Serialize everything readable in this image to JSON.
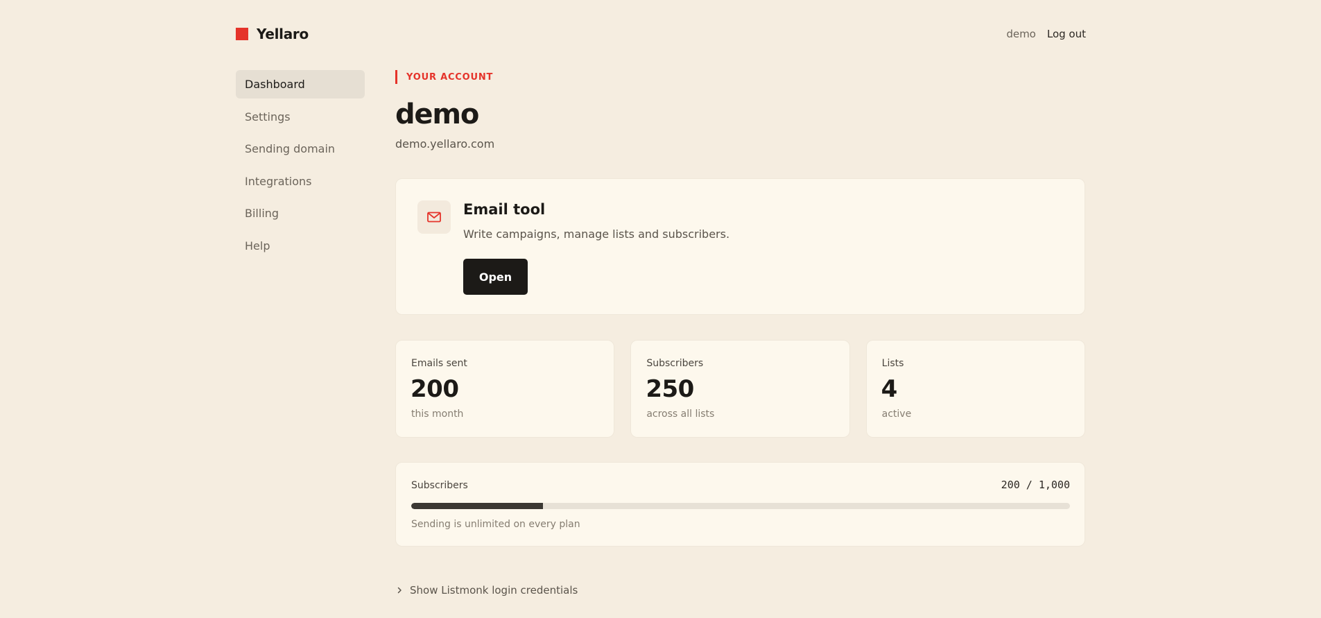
{
  "brand": {
    "name": "Yellaro",
    "color": "#e5332a"
  },
  "header": {
    "username": "demo",
    "logout_label": "Log out"
  },
  "sidebar": {
    "items": [
      {
        "label": "Dashboard",
        "active": true
      },
      {
        "label": "Settings",
        "active": false
      },
      {
        "label": "Sending domain",
        "active": false
      },
      {
        "label": "Integrations",
        "active": false
      },
      {
        "label": "Billing",
        "active": false
      },
      {
        "label": "Help",
        "active": false
      }
    ]
  },
  "account": {
    "eyebrow": "YOUR ACCOUNT",
    "name": "demo",
    "domain": "demo.yellaro.com"
  },
  "tool": {
    "icon": "mail-icon",
    "title": "Email tool",
    "description": "Write campaigns, manage lists and subscribers.",
    "button_label": "Open"
  },
  "stats": [
    {
      "label": "Emails sent",
      "value": "200",
      "caption": "this month"
    },
    {
      "label": "Subscribers",
      "value": "250",
      "caption": "across all lists"
    },
    {
      "label": "Lists",
      "value": "4",
      "caption": "active"
    }
  ],
  "usage": {
    "label": "Subscribers",
    "count_text": "200 / 1,000",
    "used": 200,
    "limit": 1000,
    "note": "Sending is unlimited on every plan"
  },
  "credentials": {
    "toggle_label": "Show Listmonk login credentials",
    "icon": "chevron-right-icon"
  },
  "colors": {
    "background": "#f5ede0",
    "card": "#fdf8ed",
    "accent": "#e5332a",
    "primary_button": "#1c1a17"
  }
}
